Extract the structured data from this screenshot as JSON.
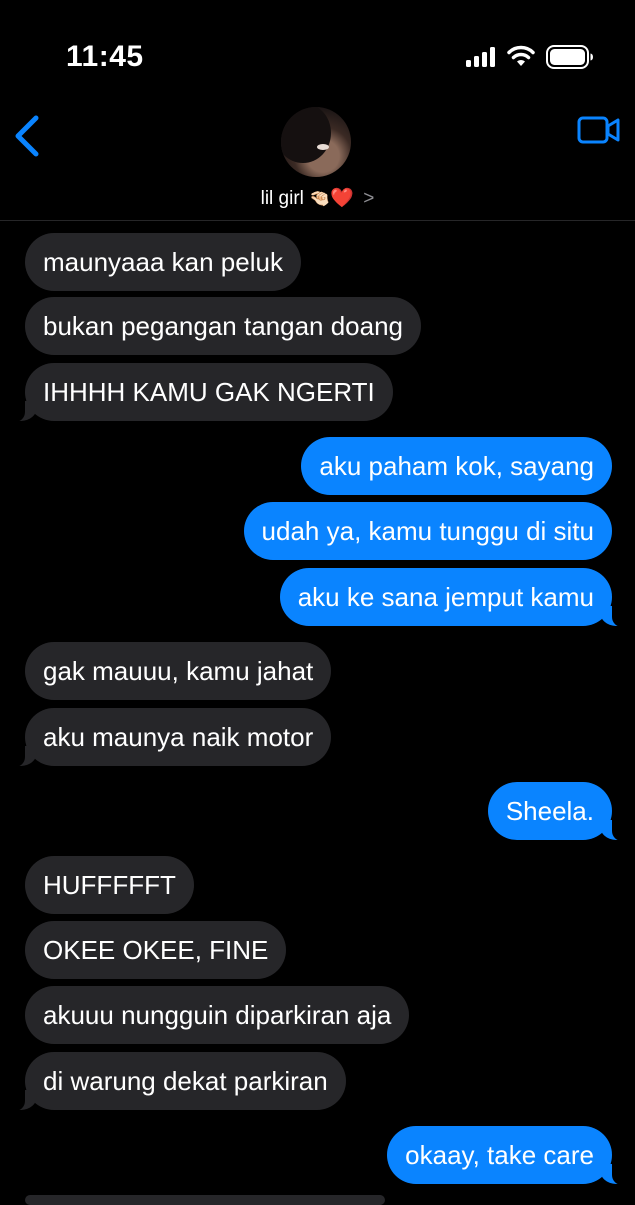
{
  "status_bar": {
    "time": "11:45",
    "icons": [
      "cellular-signal-icon",
      "wifi-icon",
      "battery-icon"
    ]
  },
  "header": {
    "back_icon": "chevron-left-icon",
    "contact_name": "lil girl",
    "contact_emoji": "🤏🏻",
    "contact_heart": "❤️",
    "contact_chevron": ">",
    "video_icon": "video-camera-icon",
    "accent_color": "#0a84ff"
  },
  "colors": {
    "background": "#000000",
    "incoming_bubble": "#262629",
    "outgoing_bubble": "#0a84ff"
  },
  "messages": [
    {
      "dir": "in",
      "text": "maunyaaa kan peluk"
    },
    {
      "dir": "in",
      "text": "bukan pegangan tangan doang"
    },
    {
      "dir": "in",
      "text": "IHHHH KAMU GAK NGERTI"
    },
    {
      "dir": "out",
      "text": "aku paham kok, sayang"
    },
    {
      "dir": "out",
      "text": "udah ya, kamu tunggu di situ"
    },
    {
      "dir": "out",
      "text": "aku ke sana jemput kamu"
    },
    {
      "dir": "in",
      "text": "gak mauuu, kamu jahat"
    },
    {
      "dir": "in",
      "text": "aku maunya naik motor"
    },
    {
      "dir": "out",
      "text": "Sheela."
    },
    {
      "dir": "in",
      "text": "HUFFFFFT"
    },
    {
      "dir": "in",
      "text": "OKEE OKEE, FINE"
    },
    {
      "dir": "in",
      "text": "akuuu nungguin diparkiran aja"
    },
    {
      "dir": "in",
      "text": "di warung dekat parkiran"
    },
    {
      "dir": "out",
      "text": "okaay, take care"
    }
  ]
}
